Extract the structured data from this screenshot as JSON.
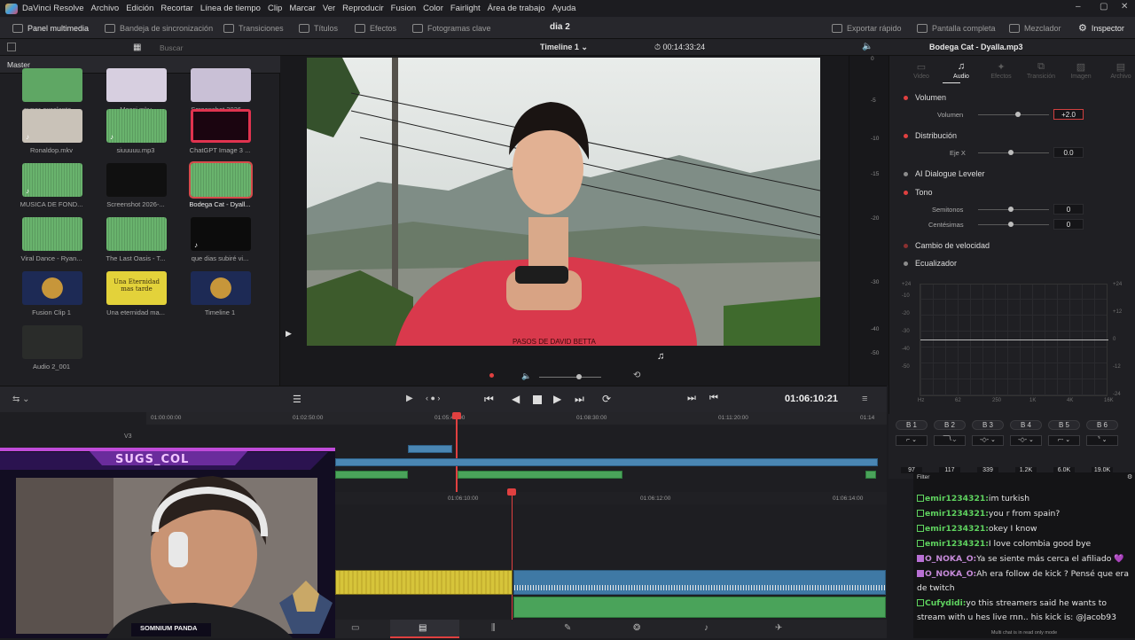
{
  "menu": {
    "app": "DaVinci Resolve",
    "items": [
      "Archivo",
      "Edición",
      "Recortar",
      "Línea de tiempo",
      "Clip",
      "Marcar",
      "Ver",
      "Reproducir",
      "Fusion",
      "Color",
      "Fairlight",
      "Área de trabajo",
      "Ayuda"
    ]
  },
  "toolbar": {
    "media_panel": "Panel multimedia",
    "sync_bin": "Bandeja de sincronización",
    "transitions": "Transiciones",
    "titles": "Títulos",
    "effects": "Efectos",
    "keyframes": "Fotogramas clave",
    "project_title": "dia 2",
    "quick_export": "Exportar rápido",
    "fullscreen": "Pantalla completa",
    "mixer": "Mezclador",
    "inspector": "Inspector"
  },
  "subbar": {
    "search_placeholder": "Buscar",
    "timeline_name": "Timeline 1",
    "timecode": "00:14:33:24",
    "clip_title": "Bodega Cat - Dyalla.mp3"
  },
  "media_pool": {
    "bin": "Master",
    "clips": [
      {
        "name": "super-excelente-..."
      },
      {
        "name": "Messi.mkv"
      },
      {
        "name": "Screenshot 2026-..."
      },
      {
        "name": "Ronaldop.mkv"
      },
      {
        "name": "siuuuuu.mp3"
      },
      {
        "name": "ChatGPT Image 3 ..."
      },
      {
        "name": "MUSICA DE FOND..."
      },
      {
        "name": "Screenshot 2026-..."
      },
      {
        "name": "Bodega Cat - Dyall..."
      },
      {
        "name": "Viral Dance - Ryan..."
      },
      {
        "name": "The Last Oasis - T..."
      },
      {
        "name": "que dias subiré vi..."
      },
      {
        "name": "Fusion Clip 1"
      },
      {
        "name": "Una eternidad ma..."
      },
      {
        "name": "Timeline 1"
      },
      {
        "name": "Audio 2_001"
      }
    ],
    "thumb_text": "Una Eternidad mas tarde"
  },
  "inspector": {
    "tabs": [
      "Video",
      "Audio",
      "Efectos",
      "Transición",
      "Imagen",
      "Archivo"
    ],
    "active_tab": "Audio",
    "volume_section": "Volumen",
    "volume_label": "Volumen",
    "volume_value": "+2.0",
    "pan_section": "Distribución",
    "pan_label": "Eje X",
    "pan_value": "0.0",
    "dialogue_leveler": "AI Dialogue Leveler",
    "pitch_section": "Tono",
    "semitones_label": "Semitonos",
    "semitones_value": "0",
    "cents_label": "Centésimas",
    "cents_value": "0",
    "speed_change": "Cambio de velocidad",
    "equalizer": "Ecualizador",
    "eq_left_scale": [
      "+24",
      "-10",
      "-20",
      "-30",
      "-40",
      "-50"
    ],
    "eq_right_scale": [
      "+24",
      "+12",
      "0",
      "-12",
      "-24"
    ],
    "eq_freqs": [
      "Hz",
      "62",
      "250",
      "1K",
      "4K",
      "16K"
    ],
    "bands": [
      "B 1",
      "B 2",
      "B 3",
      "B 4",
      "B 5",
      "B 6"
    ],
    "band_values": [
      "97",
      "117",
      "339",
      "1.2K",
      "6.0K",
      "19.0K"
    ]
  },
  "meter_scale": [
    "0",
    "-5",
    "-10",
    "-15",
    "-20",
    "-30",
    "-40",
    "-50"
  ],
  "transport": {
    "timecode": "01:06:10:21"
  },
  "timeline": {
    "ruler_top": [
      "01:00:00:00",
      "01:02:50:00",
      "01:05:40:00",
      "01:08:30:00",
      "01:11:20:00",
      "01:14"
    ],
    "ruler_zoom": [
      "01:06:10:00",
      "01:06:12:00",
      "01:06:14:00"
    ],
    "track_v3": "V3"
  },
  "chat": {
    "header": "Filter",
    "messages": [
      {
        "user": "emir1234321",
        "text": "im turkish",
        "type": "g"
      },
      {
        "user": "emir1234321",
        "text": "you r from spain?",
        "type": "g"
      },
      {
        "user": "emir1234321",
        "text": "okey I know",
        "type": "g"
      },
      {
        "user": "emir1234321",
        "text": "I love colombia good bye",
        "type": "g"
      },
      {
        "user": "O_NOKA_O",
        "text": "Ya se siente más cerca el afiliado 💜",
        "type": "p"
      },
      {
        "user": "O_NOKA_O",
        "text": "Ah era follow de kick ? Pensé que era de twitch",
        "type": "p"
      },
      {
        "user": "Cufydidi",
        "text": "yo this streamers said he wants to stream with u hes live rnn.. his kick is: @Jacob93",
        "type": "g"
      }
    ],
    "footer": "Multi chat is in read only mode"
  },
  "overlay": {
    "streamer_name": "SUGS_COL",
    "brand": "SOMNIUM PANDA"
  },
  "video_shirt_text": "PASOS DE DAVID BETTA"
}
